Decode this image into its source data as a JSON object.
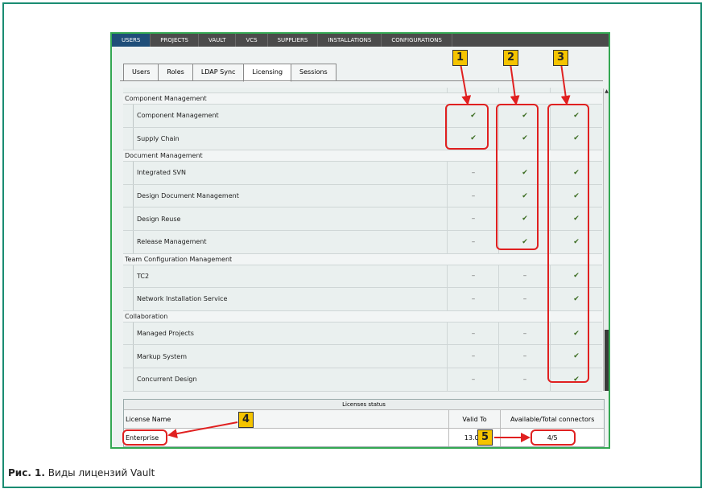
{
  "nav": [
    "USERS",
    "PROJECTS",
    "VAULT",
    "VCS",
    "SUPPLIERS",
    "INSTALLATIONS",
    "CONFIGURATIONS"
  ],
  "subtabs": [
    "Users",
    "Roles",
    "LDAP Sync",
    "Licensing",
    "Sessions"
  ],
  "check_symbol": "✔",
  "dash_symbol": "–",
  "groups": [
    {
      "title": "Component Management",
      "rows": [
        {
          "name": "Component Management",
          "v": [
            1,
            1,
            1
          ]
        },
        {
          "name": "Supply Chain",
          "v": [
            1,
            1,
            1
          ]
        }
      ]
    },
    {
      "title": "Document Management",
      "rows": [
        {
          "name": "Integrated SVN",
          "v": [
            0,
            1,
            1
          ]
        },
        {
          "name": "Design Document Management",
          "v": [
            0,
            1,
            1
          ]
        },
        {
          "name": "Design Reuse",
          "v": [
            0,
            1,
            1
          ]
        },
        {
          "name": "Release Management",
          "v": [
            0,
            1,
            1
          ]
        }
      ]
    },
    {
      "title": "Team Configuration Management",
      "rows": [
        {
          "name": "TC2",
          "v": [
            0,
            0,
            1
          ]
        },
        {
          "name": "Network Installation Service",
          "v": [
            0,
            0,
            1
          ]
        }
      ]
    },
    {
      "title": "Collaboration",
      "rows": [
        {
          "name": "Managed Projects",
          "v": [
            0,
            0,
            1
          ]
        },
        {
          "name": "Markup System",
          "v": [
            0,
            0,
            1
          ]
        },
        {
          "name": "Concurrent Design",
          "v": [
            0,
            0,
            1
          ]
        }
      ]
    }
  ],
  "license": {
    "header": "Licenses status",
    "col_name": "License Name",
    "col_valid": "Valid To",
    "col_avail": "Available/Total connectors",
    "name": "Enterprise",
    "valid": "13.08.",
    "avail": "4/5"
  },
  "callouts": [
    "1",
    "2",
    "3",
    "4",
    "5"
  ],
  "caption_bold": "Рис. 1.",
  "caption_text": " Виды лицензий Vault"
}
